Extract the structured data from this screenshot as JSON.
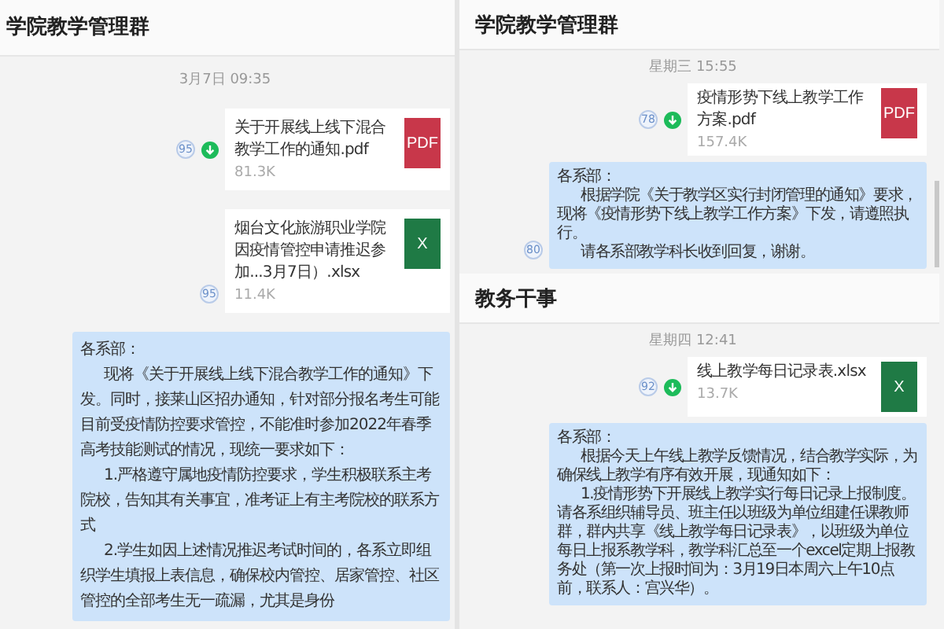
{
  "panels": [
    {
      "chats": [
        {
          "title": "学院教学管理群",
          "timestamp": "3月7日 09:35",
          "messages": [
            {
              "kind": "file",
              "color": "#c8374a",
              "icon_label": "PDF",
              "name": "关于开展线上线下混合教学工作的通知.pdf",
              "size": "81.3K",
              "read_count": "95",
              "downloaded": true
            },
            {
              "kind": "file",
              "color": "#1f7a45",
              "icon_label": "X",
              "name": "烟台文化旅游职业学院因疫情管控申请推迟参加...3月7日）.xlsx",
              "size": "11.4K",
              "read_count": "95",
              "downloaded": false
            },
            {
              "kind": "text",
              "paragraphs": [
                "各系部：",
                "现将《关于开展线上线下混合教学工作的通知》下发。同时，接莱山区招办通知，针对部分报名考生可能目前受疫情防控要求管控，不能准时参加2022年春季高考技能测试的情况，现统一要求如下：",
                "1.严格遵守属地疫情防控要求，学生积极联系主考院校，告知其有关事宜，准考证上有主考院校的联系方式",
                "2.学生如因上述情况推迟考试时间的，各系立即组织学生填报上表信息，确保校内管控、居家管控、社区管控的全部考生无一疏漏，尤其是身份"
              ]
            }
          ]
        }
      ]
    },
    {
      "chats": [
        {
          "title": "学院教学管理群",
          "timestamp": "星期三 15:55",
          "messages": [
            {
              "kind": "file",
              "color": "#c8374a",
              "icon_label": "PDF",
              "name": "疫情形势下线上教学工作方案.pdf",
              "size": "157.4K",
              "read_count": "78",
              "downloaded": true
            },
            {
              "kind": "text",
              "paragraphs": [
                "各系部：",
                "根据学院《关于教学区实行封闭管理的通知》要求，现将《疫情形势下线上教学工作方案》下发，请遵照执行。",
                "请各系部教学科长收到回复，谢谢。"
              ],
              "read_count": "80"
            }
          ]
        },
        {
          "title": "教务干事",
          "timestamp": "星期四 12:41",
          "messages": [
            {
              "kind": "file",
              "color": "#1f7a45",
              "icon_label": "X",
              "name": "线上教学每日记录表.xlsx",
              "size": "13.7K",
              "read_count": "92",
              "downloaded": true
            },
            {
              "kind": "text",
              "paragraphs": [
                "各系部：",
                "根据今天上午线上教学反馈情况，结合教学实际，为确保线上教学有序有效开展，现通知如下：",
                "1.疫情形势下开展线上教学实行每日记录上报制度。请各系组织辅导员、班主任以班级为单位组建任课教师群，群内共享《线上教学每日记录表》，以班级为单位每日上报系教学科，教学科汇总至一个excel定期上报教务处（第一次上报时间为：3月19日本周六上午10点前，联系人：宫兴华）。"
              ]
            }
          ]
        }
      ]
    }
  ]
}
